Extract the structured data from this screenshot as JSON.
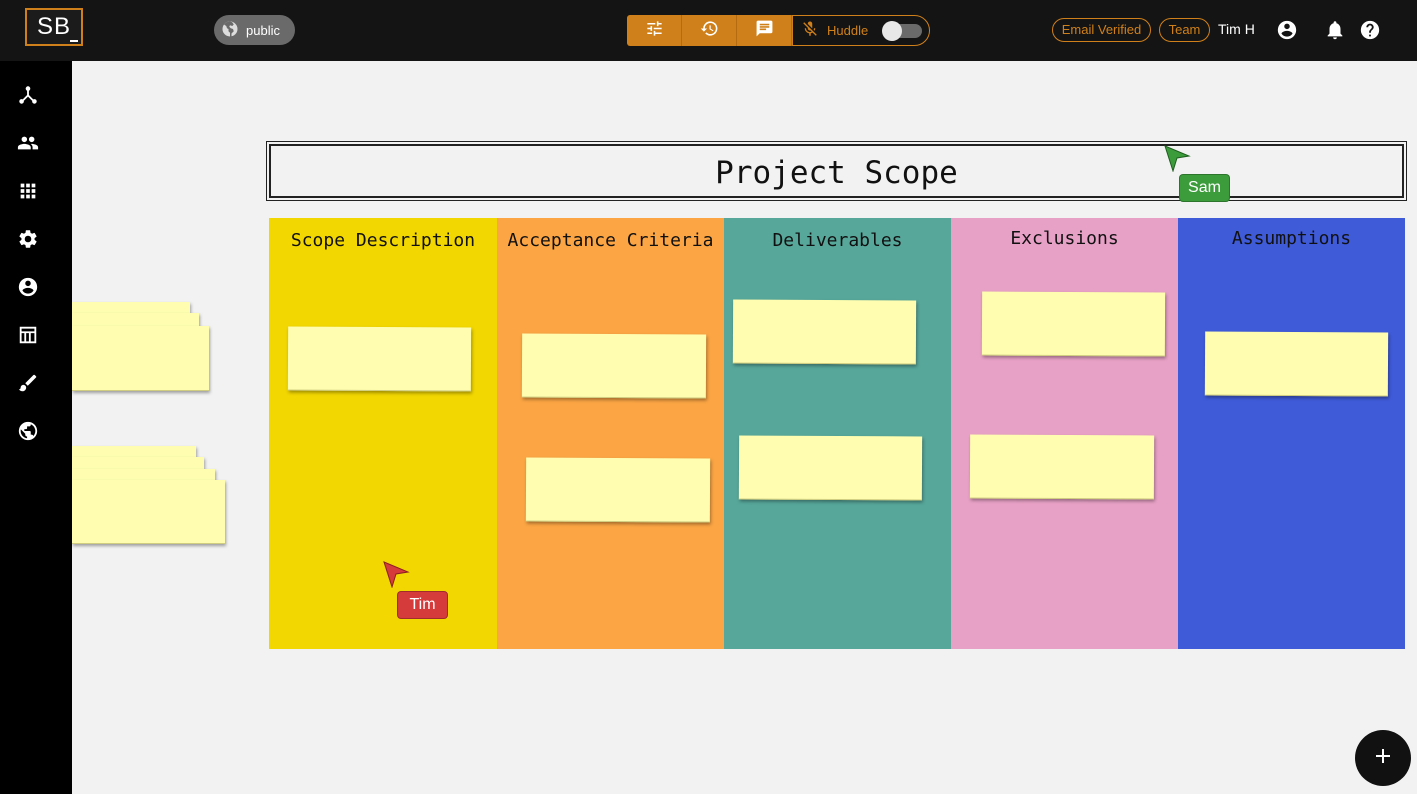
{
  "app": {
    "logo_text": "SB"
  },
  "visibility": {
    "label": "public",
    "icon": "globe-icon"
  },
  "toolbar": {
    "buttons": [
      {
        "name": "settings-sliders",
        "icon": "sliders-icon"
      },
      {
        "name": "history",
        "icon": "history-icon"
      },
      {
        "name": "chat",
        "icon": "chat-icon"
      }
    ],
    "huddle_label": "Huddle",
    "huddle_on": false
  },
  "header": {
    "email_badge": "Email Verified",
    "team_badge": "Team",
    "user_name": "Tim H",
    "icons": [
      "account-icon",
      "bell-icon",
      "help-icon"
    ]
  },
  "sidebar": {
    "items": [
      "network-icon",
      "people-icon",
      "grid-icon",
      "gear-icon",
      "profile-icon",
      "table-icon",
      "brush-icon",
      "globe-icon"
    ]
  },
  "board": {
    "title": "Project Scope",
    "columns": [
      {
        "title": "Scope Description",
        "color": "#f2d700"
      },
      {
        "title": "Acceptance Criteria",
        "color": "#fba544"
      },
      {
        "title": "Deliverables",
        "color": "#57a79b"
      },
      {
        "title": "Exclusions",
        "color": "#e8a1c6"
      },
      {
        "title": "Assumptions",
        "color": "#3f5bd8"
      }
    ],
    "sticky_color": "#fffeb0"
  },
  "cursors": [
    {
      "name": "Tim",
      "color": "#d63b3b"
    },
    {
      "name": "Sam",
      "color": "#3c9c3c"
    }
  ]
}
